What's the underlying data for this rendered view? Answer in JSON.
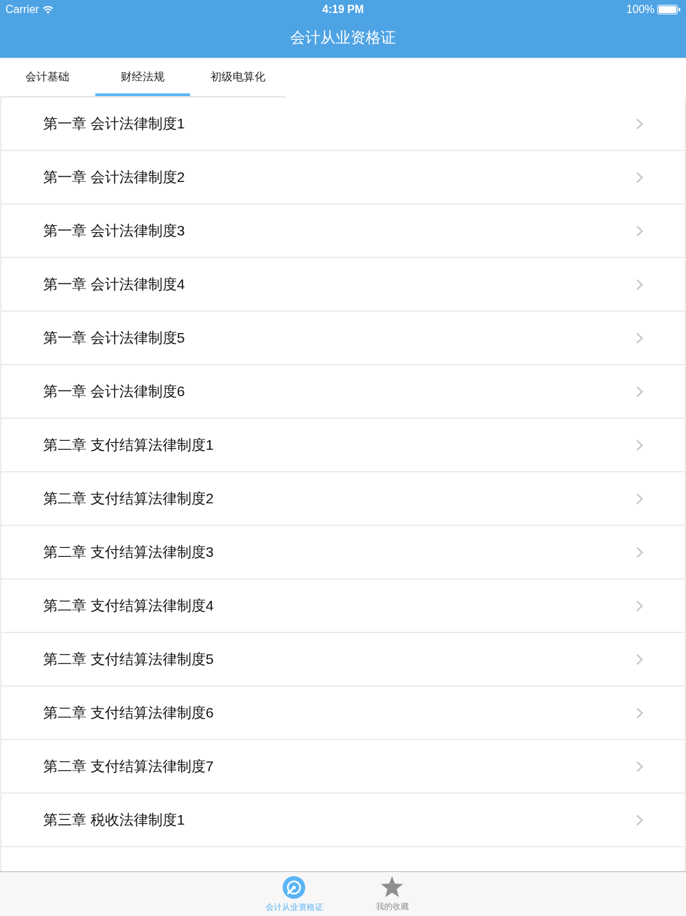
{
  "status_bar": {
    "carrier": "Carrier",
    "time": "4:19 PM",
    "battery": "100%"
  },
  "nav_bar": {
    "title": "会计从业资格证"
  },
  "tabs": [
    {
      "label": "会计基础",
      "selected": false
    },
    {
      "label": "财经法规",
      "selected": true
    },
    {
      "label": "初级电算化",
      "selected": false
    }
  ],
  "rows": [
    {
      "title": "第一章 会计法律制度1"
    },
    {
      "title": "第一章 会计法律制度2"
    },
    {
      "title": "第一章 会计法律制度3"
    },
    {
      "title": "第一章 会计法律制度4"
    },
    {
      "title": "第一章 会计法律制度5"
    },
    {
      "title": "第一章 会计法律制度6"
    },
    {
      "title": "第二章 支付结算法律制度1"
    },
    {
      "title": "第二章 支付结算法律制度2"
    },
    {
      "title": "第二章 支付结算法律制度3"
    },
    {
      "title": "第二章 支付结算法律制度4"
    },
    {
      "title": "第二章 支付结算法律制度5"
    },
    {
      "title": "第二章 支付结算法律制度6"
    },
    {
      "title": "第二章 支付结算法律制度7"
    },
    {
      "title": "第三章 税收法律制度1"
    }
  ],
  "tab_bar": [
    {
      "label": "会计从业资格证",
      "selected": true
    },
    {
      "label": "我的收藏",
      "selected": false
    }
  ]
}
